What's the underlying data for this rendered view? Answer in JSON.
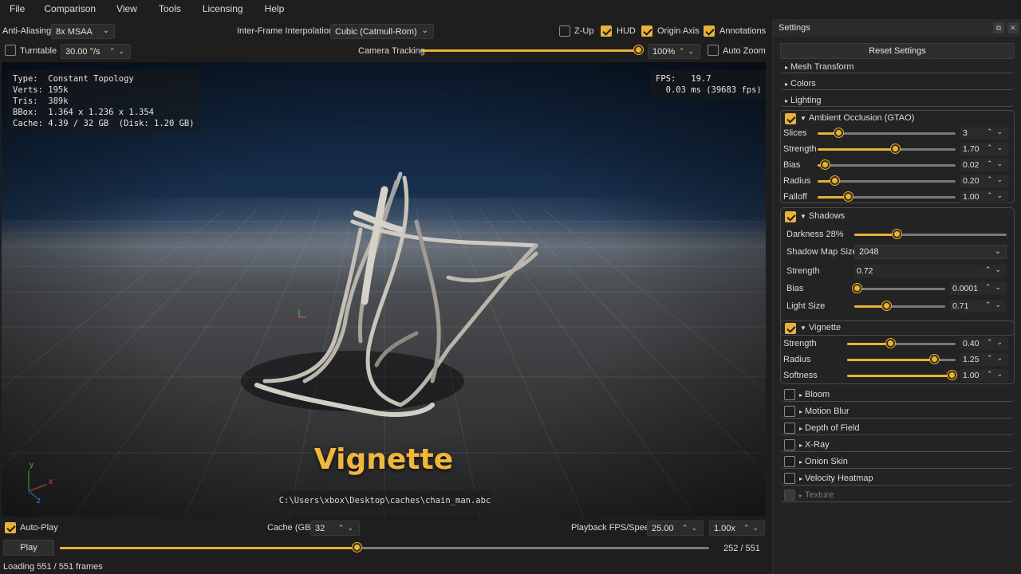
{
  "menu": [
    "File",
    "Comparison",
    "View",
    "Tools",
    "Licensing",
    "Help"
  ],
  "toolbar": {
    "anti_aliasing_label": "Anti-Aliasing",
    "anti_aliasing_value": "8x MSAA",
    "interp_label": "Inter-Frame Interpolation",
    "interp_value": "Cubic (Catmull-Rom)",
    "zup_label": "Z-Up",
    "zup_checked": false,
    "hud_label": "HUD",
    "hud_checked": true,
    "origin_axis_label": "Origin Axis",
    "origin_axis_checked": true,
    "annotations_label": "Annotations",
    "annotations_checked": true,
    "turntable_label": "Turntable",
    "turntable_checked": false,
    "turntable_speed": "30.00 °/s",
    "camera_tracking_label": "Camera Tracking",
    "camera_tracking_level": 1.0,
    "zoom_value": "100%",
    "auto_zoom_label": "Auto Zoom",
    "auto_zoom_checked": false
  },
  "viewport": {
    "info_lines": "Type:  Constant Topology\nVerts: 195k\nTris:  389k\nBBox:  1.364 x 1.236 x 1.354\nCache: 4.39 / 32 GB  (Disk: 1.20 GB)",
    "fps_lines": "FPS:   19.7\n  0.03 ms (39683 fps)",
    "annotation_title": "Vignette",
    "file_path": "C:\\Users\\xbox\\Desktop\\caches\\chain_man.abc",
    "gizmo_y": "y",
    "gizmo_x": "x",
    "gizmo_z": "z"
  },
  "settings": {
    "title": "Settings",
    "reset_label": "Reset Settings",
    "collapsed_top": [
      "Mesh Transform",
      "Colors",
      "Lighting"
    ],
    "gtao": {
      "title": "Ambient Occlusion (GTAO)",
      "enabled": true,
      "rows": [
        {
          "label": "Slices",
          "value": "3",
          "level": 0.15
        },
        {
          "label": "Strength",
          "value": "1.70",
          "level": 0.56
        },
        {
          "label": "Bias",
          "value": "0.02",
          "level": 0.05
        },
        {
          "label": "Radius",
          "value": "0.20",
          "level": 0.12
        },
        {
          "label": "Falloff",
          "value": "1.00",
          "level": 0.22
        }
      ]
    },
    "shadows": {
      "title": "Shadows",
      "enabled": true,
      "darkness_label": "Darkness 28%",
      "darkness_level": 0.28,
      "map_size_label": "Shadow Map Size",
      "map_size_value": "2048",
      "strength_label": "Strength",
      "strength_value": "0.72",
      "bias_label": "Bias",
      "bias_value": "0.0001",
      "bias_level": 0.03,
      "light_size_label": "Light Size",
      "light_size_value": "0.71",
      "light_size_level": 0.35
    },
    "vignette": {
      "title": "Vignette",
      "enabled": true,
      "rows": [
        {
          "label": "Strength",
          "value": "0.40",
          "level": 0.4
        },
        {
          "label": "Radius",
          "value": "1.25",
          "level": 0.8
        },
        {
          "label": "Softness",
          "value": "1.00",
          "level": 0.96
        }
      ]
    },
    "collapsed_bottom": [
      {
        "label": "Bloom",
        "enabled": false
      },
      {
        "label": "Motion Blur",
        "enabled": false
      },
      {
        "label": "Depth of Field",
        "enabled": false
      },
      {
        "label": "X-Ray",
        "enabled": false
      },
      {
        "label": "Onion Skin",
        "enabled": false
      },
      {
        "label": "Velocity Heatmap",
        "enabled": false
      },
      {
        "label": "Texture",
        "enabled": false,
        "disabled": true
      }
    ]
  },
  "bottom": {
    "autoplay_label": "Auto-Play",
    "autoplay_checked": true,
    "cache_label": "Cache (GB)",
    "cache_value": "32",
    "playback_label": "Playback FPS/Speed",
    "fps_value": "25.00",
    "speed_value": "1.00x",
    "play_label": "Play",
    "frame_counter": "252 / 551",
    "timeline_progress": 0.457,
    "status": "Loading 551 / 551 frames"
  },
  "colors": {
    "accent": "#e8b23a",
    "panel": "#232323",
    "background": "#1e1e1e"
  }
}
